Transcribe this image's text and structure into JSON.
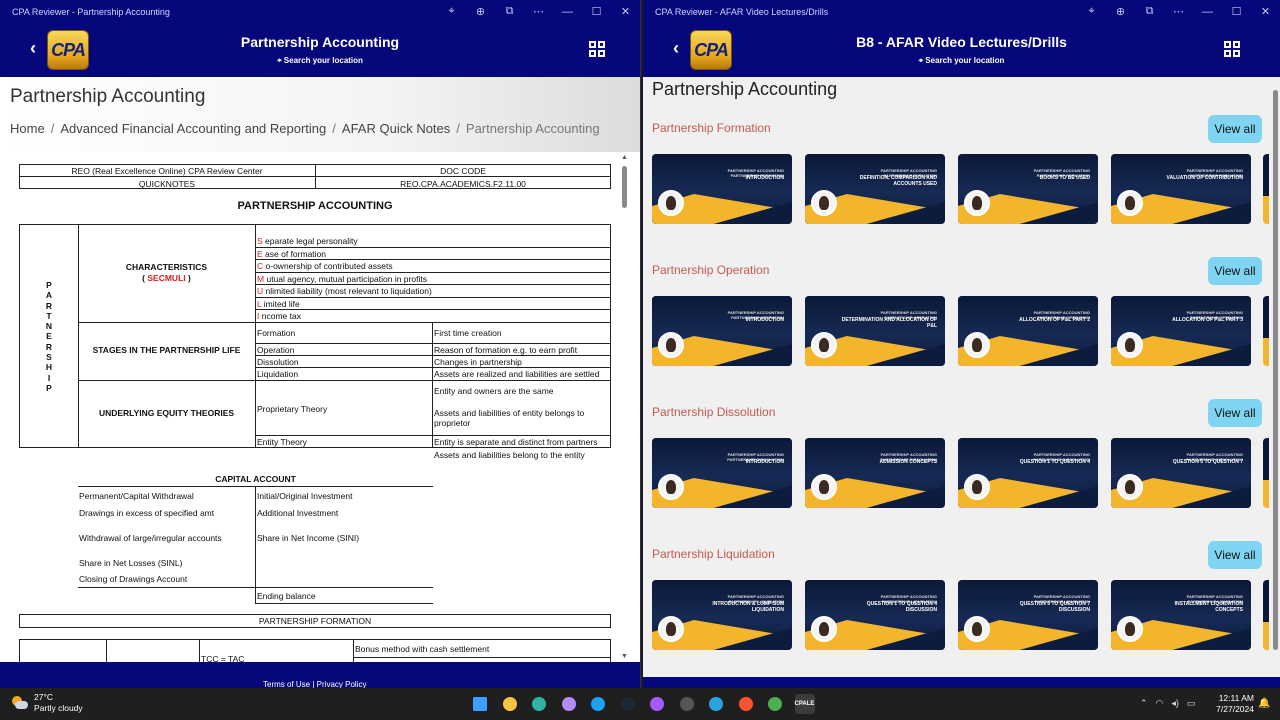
{
  "left_window": {
    "title": "CPA Reviewer - Partnership Accounting",
    "header_title": "Partnership Accounting",
    "location": "Search your location",
    "logo_text": "CPA",
    "page_title": "Partnership Accounting",
    "breadcrumbs": [
      "Home",
      "Advanced Financial Accounting and Reporting",
      "AFAR Quick Notes",
      "Partnership Accounting"
    ],
    "footer_links": [
      "Terms of Use",
      "|",
      "Privacy Policy"
    ]
  },
  "doc": {
    "header_table": {
      "r1c1": "REO (Real Excellence Online) CPA Review Center",
      "r1c2": "DOC CODE",
      "r2c1": "QUICKNOTES",
      "r2c2": "REO.CPA.ACADEMICS.F2.11.00"
    },
    "title": "PARTNERSHIP ACCOUNTING",
    "vertical_label": [
      "P",
      "A",
      "R",
      "T",
      "N",
      "E",
      "R",
      "S",
      "H",
      "I",
      "P"
    ],
    "characteristics_label": "CHARACTERISTICS",
    "secmuli_open": "( ",
    "secmuli": "SECMULI",
    "secmuli_close": " )",
    "characteristics": [
      {
        "letter": "S",
        "text": "eparate legal personality"
      },
      {
        "letter": "E",
        "text": "ase of formation"
      },
      {
        "letter": "C",
        "text": "o-ownership of contributed assets"
      },
      {
        "letter": "M",
        "text": "utual agency, mutual participation in profits"
      },
      {
        "letter": "U",
        "text": "nlimited liability (most relevant to liquidation)"
      },
      {
        "letter": "L",
        "text": "imited life"
      },
      {
        "letter": "I",
        "text": "ncome tax"
      }
    ],
    "stages_label": "STAGES IN THE PARTNERSHIP LIFE",
    "stages": [
      {
        "stage": "Formation",
        "desc": "First time creation"
      },
      {
        "stage": "Operation",
        "desc": "Reason of formation e.g. to earn profit"
      },
      {
        "stage": "Dissolution",
        "desc": "Changes in partnership"
      },
      {
        "stage": "Liquidation",
        "desc": "Assets are realized and liabilities are settled"
      }
    ],
    "equity_label": "UNDERLYING EQUITY THEORIES",
    "proprietary": "Proprietary Theory",
    "proprietary_d1": "Entity and owners are the same",
    "proprietary_d2": "Assets and liabilities of entity belongs to proprietor",
    "entity": "Entity Theory",
    "entity_d1": "Entity is separate and distinct from partners",
    "entity_d2": "Assets and liabilities belong to the entity",
    "capital_title": "CAPITAL ACCOUNT",
    "capital_left": [
      "Permanent/Capital Withdrawal",
      "Drawings in excess of specified amt",
      "Withdrawal of large/irregular accounts",
      "Share in Net Losses (SINL)",
      "Closing of Drawings Account"
    ],
    "capital_right": [
      "Initial/Original Investment",
      "Additional Investment",
      "Share in Net Income (SINI)"
    ],
    "ending_balance": "Ending balance",
    "formation_title": "PARTNERSHIP FORMATION",
    "tcc": "TCC = TAC",
    "bonus": "Bonus method with cash settlement"
  },
  "right_window": {
    "title": "CPA Reviewer - AFAR Video Lectures/Drills",
    "header_title": "B8 - AFAR Video Lectures/Drills",
    "location": "Search your location",
    "logo_text": "CPA",
    "page_title": "Partnership Accounting",
    "view_all": "View all",
    "sections": [
      {
        "title": "Partnership Formation",
        "category": "PARTNERSHIP ACCOUNTING\nPARTNERSHIP FORMATION",
        "videos": [
          "INTRODUCTION",
          "DEFINITION, COMPARISON AND ACCOUNTS USED",
          "BOOKS TO BE USED",
          "VALUATION OF CONTRIBUTION"
        ]
      },
      {
        "title": "Partnership Operation",
        "category": "PARTNERSHIP ACCOUNTING\nPARTNERSHIP OPERATION",
        "videos": [
          "INTRODUCTION",
          "DETERMINATION AND ALLOCATION OF P&L",
          "ALLOCATION OF P&L PART 2",
          "ALLOCATION OF P&L PART 3"
        ]
      },
      {
        "title": "Partnership Dissolution",
        "category": "PARTNERSHIP ACCOUNTING\nPARTNERSHIP DISSOLUTION",
        "videos": [
          "INTRODUCTION",
          "ADMISSION CONCEPTS",
          "QUESTION 1 TO QUESTION 4",
          "QUESTION 5 TO QUESTION 7"
        ]
      },
      {
        "title": "Partnership Liquidation",
        "category": "PARTNERSHIP ACCOUNTING\nPARTNERSHIP LIQUIDATION",
        "videos": [
          "INTRODUCTION & LUMP-SUM LIQUIDATION",
          "QUESTION 1 TO QUESTION 4 DISCUSSION",
          "QUESTION 5 TO QUESTION 7 DISCUSSION",
          "INSTALLMENT LIQUIDATION CONCEPTS"
        ]
      }
    ]
  },
  "taskbar": {
    "temp": "27°C",
    "weather": "Partly cloudy",
    "weather_badge": "1",
    "time": "12:11 AM",
    "date": "7/27/2024",
    "apps": [
      "windows-start",
      "file-explorer",
      "edge",
      "app-drop",
      "skype",
      "steam",
      "messenger",
      "cube-app",
      "telegram",
      "brave",
      "chrome",
      "cpa-app"
    ],
    "active_app_label": "CPALE"
  }
}
